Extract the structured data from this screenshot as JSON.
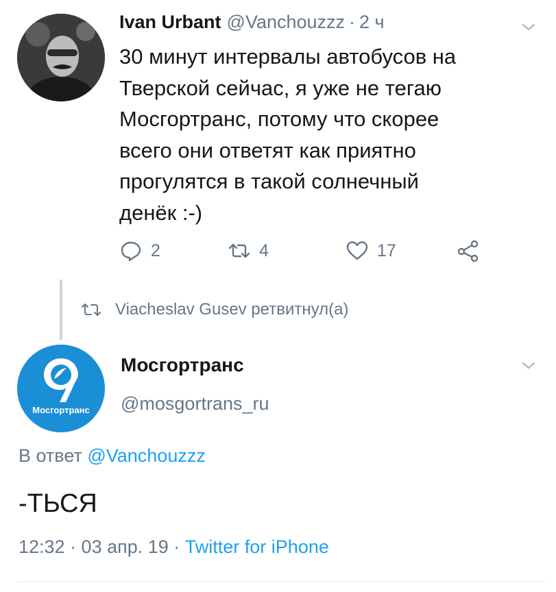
{
  "tweet1": {
    "author_name": "Ivan Urbant",
    "author_handle": "@Vanchouzzz",
    "separator": "·",
    "time": "2 ч",
    "text": "30 минут интервалы автобусов на\nТверской сейчас, я уже не тегаю\nМосгортранс, потому что скорее\nвсего они ответят как приятно\nпрогулятся в такой солнечный\nденёк :-)",
    "replies": "2",
    "retweets": "4",
    "likes": "17"
  },
  "retweet_context": {
    "text": "Viacheslav Gusev ретвитнул(а)"
  },
  "tweet2": {
    "author_name": "Мосгортранс",
    "author_handle": "@mosgortrans_ru",
    "avatar_label": "Мосгортранс",
    "reply_prefix": "В ответ",
    "reply_mention": "@Vanchouzzz",
    "text": "-ТЬСЯ",
    "timestamp": "12:32 · 03 апр. 19 · ",
    "source": "Twitter for iPhone"
  },
  "colors": {
    "text": "#14171a",
    "secondary": "#657786",
    "link": "#1da1f2",
    "avatar_brand": "#1a8fd6",
    "divider": "#e1e8ed"
  },
  "icons": {
    "reply": "reply-icon",
    "retweet": "retweet-icon",
    "like": "like-icon",
    "share": "share-icon",
    "menu": "chevron-down-icon"
  }
}
